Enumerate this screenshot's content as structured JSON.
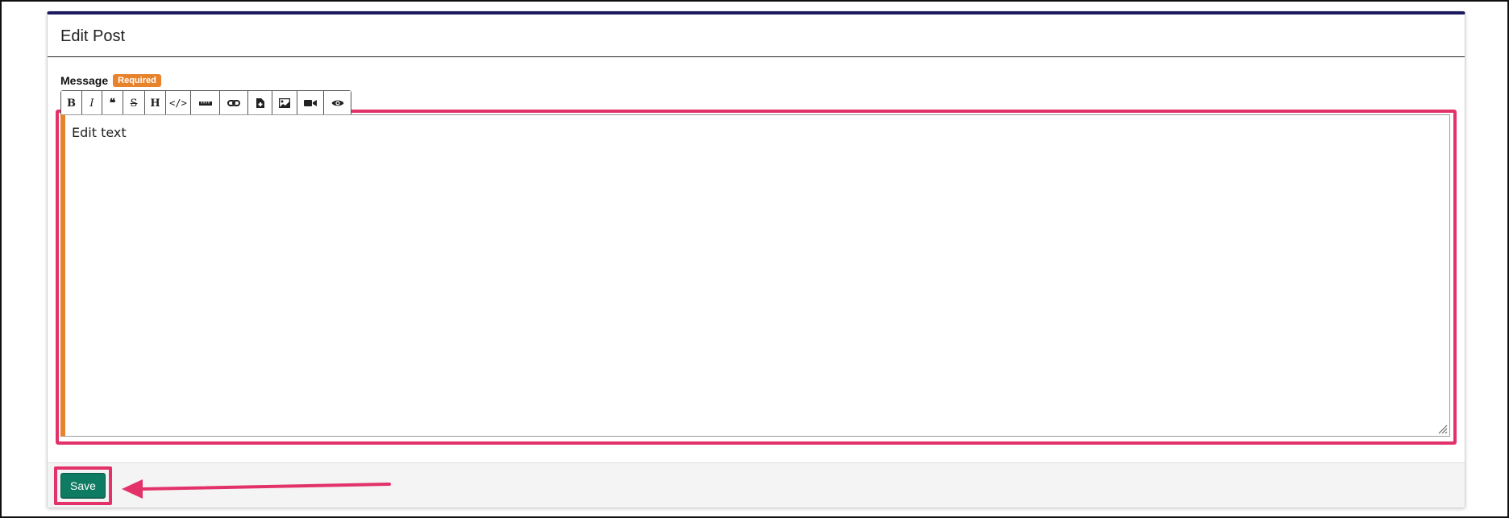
{
  "card": {
    "title": "Edit Post"
  },
  "message_field": {
    "label": "Message",
    "required_badge": "Required",
    "value": "Edit text"
  },
  "toolbar": {
    "buttons": [
      {
        "name": "bold",
        "icon": "bold-icon",
        "glyph": "B"
      },
      {
        "name": "italic",
        "icon": "italic-icon",
        "glyph": "I"
      },
      {
        "name": "quote",
        "icon": "quote-icon",
        "glyph": "❝"
      },
      {
        "name": "strikethrough",
        "icon": "strikethrough-icon",
        "glyph": "S"
      },
      {
        "name": "heading",
        "icon": "heading-icon",
        "glyph": "H"
      },
      {
        "name": "code",
        "icon": "code-icon",
        "glyph": "</>"
      },
      {
        "name": "horizontal-rule",
        "icon": "ruler-icon",
        "glyph": ""
      },
      {
        "name": "link",
        "icon": "link-icon",
        "glyph": ""
      },
      {
        "name": "file",
        "icon": "file-icon",
        "glyph": ""
      },
      {
        "name": "image",
        "icon": "image-icon",
        "glyph": ""
      },
      {
        "name": "video",
        "icon": "video-icon",
        "glyph": ""
      },
      {
        "name": "preview",
        "icon": "eye-icon",
        "glyph": ""
      }
    ]
  },
  "footer": {
    "save_label": "Save"
  },
  "colors": {
    "header_accent": "#1b1a5e",
    "required_badge": "#e8832d",
    "editor_left_bar": "#e8832d",
    "save_button": "#0f7b63",
    "annotation_highlight": "#e3326a"
  }
}
